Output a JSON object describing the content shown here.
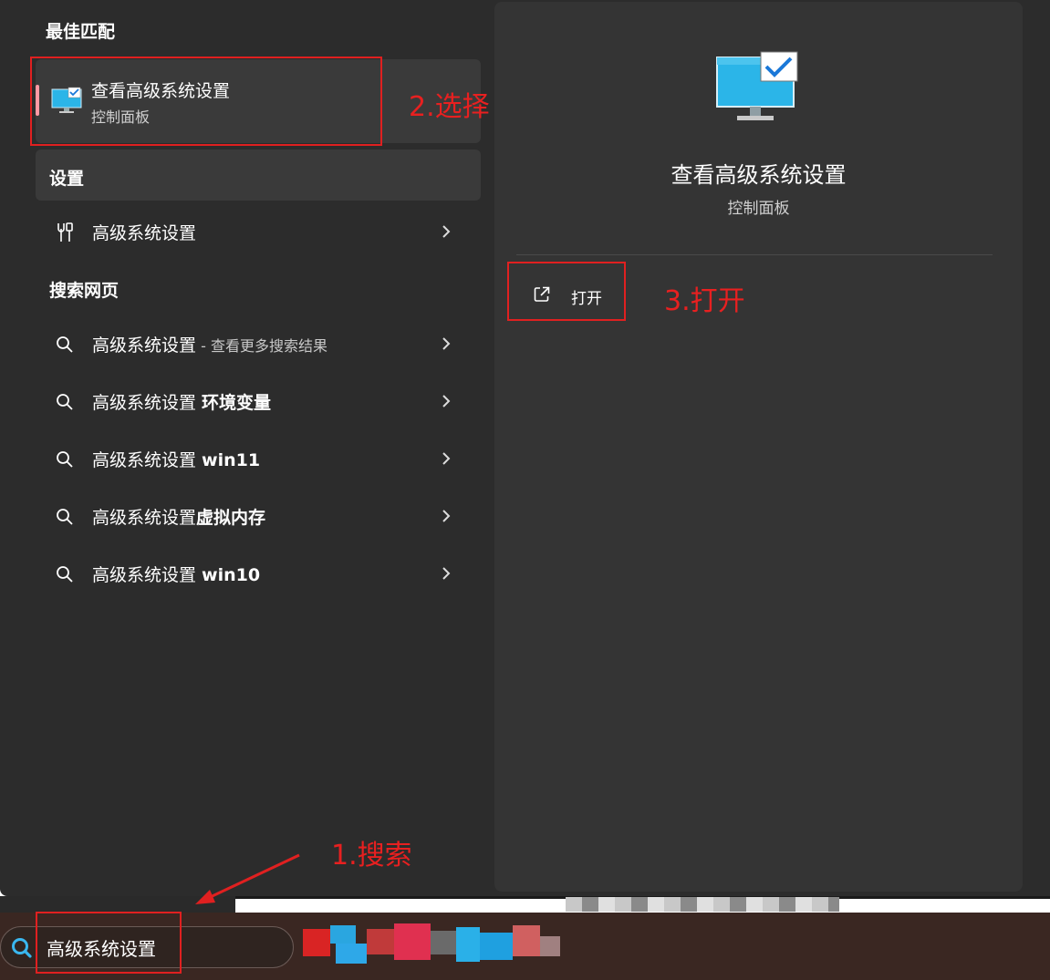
{
  "best_match": {
    "section_title": "最佳匹配",
    "item_title": "查看高级系统设置",
    "item_subtitle": "控制面板",
    "icon": "monitor-check-icon"
  },
  "settings": {
    "section_title": "设置",
    "items": [
      {
        "label": "高级系统设置",
        "icon": "settings-tools-icon"
      }
    ]
  },
  "web_search": {
    "section_title": "搜索网页",
    "items": [
      {
        "label": "高级系统设置",
        "suffix": " - 查看更多搜索结果",
        "bold": ""
      },
      {
        "label": "高级系统设置 ",
        "suffix": "",
        "bold": "环境变量"
      },
      {
        "label": "高级系统设置 ",
        "suffix": "",
        "bold": "win11"
      },
      {
        "label": "高级系统设置",
        "suffix": "",
        "bold": "虚拟内存"
      },
      {
        "label": "高级系统设置 ",
        "suffix": "",
        "bold": "win10"
      }
    ]
  },
  "detail": {
    "title": "查看高级系统设置",
    "subtitle": "控制面板",
    "open_label": "打开",
    "icon": "monitor-check-icon"
  },
  "annotations": {
    "step1": "1.搜索",
    "step2": "2.选择",
    "step3": "3.打开"
  },
  "taskbar": {
    "search_value": "高级系统设置",
    "search_icon": "search-icon"
  },
  "colors": {
    "panel_bg": "#2c2c2c",
    "detail_bg": "#343434",
    "accent": "#ff99a4",
    "annotation_red": "#e82020"
  }
}
